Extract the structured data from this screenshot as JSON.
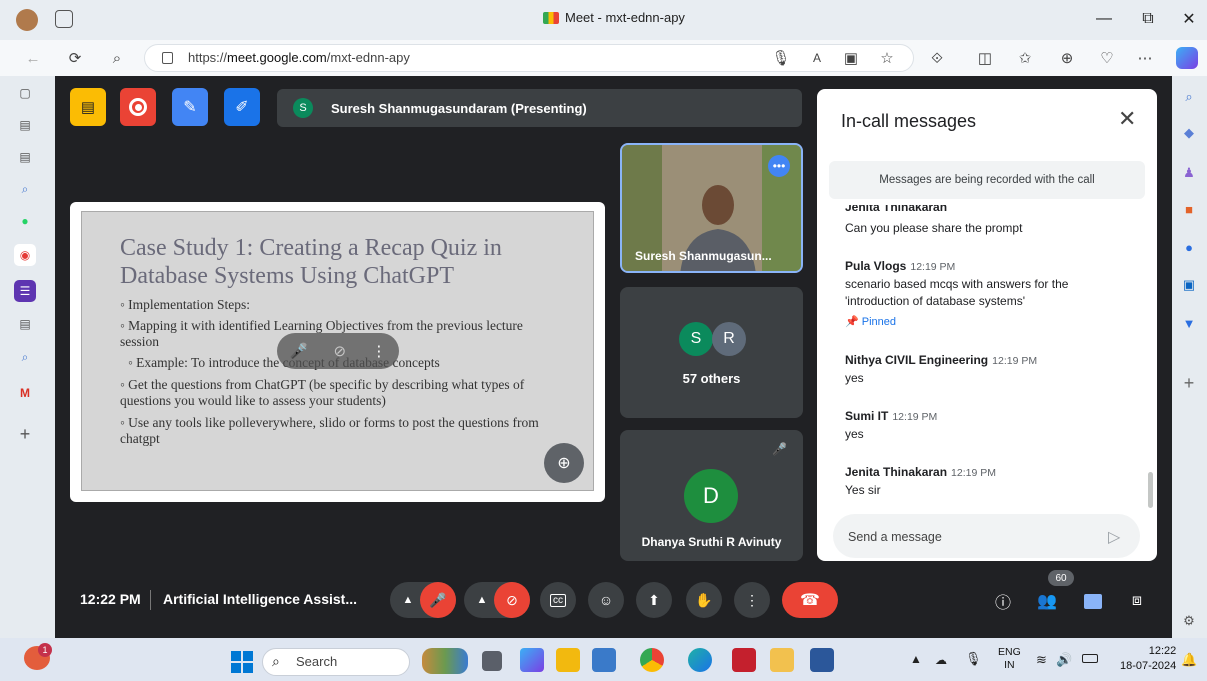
{
  "browser": {
    "tab_title": "Meet - mxt-ednn-apy",
    "url_prefix": "https://",
    "url_host": "meet.google.com",
    "url_path": "/mxt-ednn-apy"
  },
  "meet": {
    "presenting_initial": "S",
    "presenting_label": "Suresh Shanmugasundaram (Presenting)",
    "slide": {
      "title": "Case Study 1: Creating a Recap Quiz in Database Systems Using ChatGPT",
      "bullets": [
        "◦ Implementation Steps:",
        "◦ Mapping it with identified Learning Objectives from the previous lecture session",
        "◦ Example: To introduce the concept of database concepts",
        "◦ Get the questions from ChatGPT (be specific by describing what types of questions you would like to assess your students)",
        "◦ Use any tools like polleverywhere, slido or forms to post the questions from chatgpt"
      ]
    },
    "tiles": {
      "presenter_name": "Suresh Shanmugasun...",
      "group_initials": [
        "S",
        "R"
      ],
      "group_label": "57 others",
      "participant_initial": "D",
      "participant_name": "Dhanya Sruthi R Avinuty"
    },
    "bottom_bar": {
      "time": "12:22 PM",
      "meeting_name": "Artificial Intelligence Assist...",
      "people_count": "60"
    }
  },
  "chat": {
    "title": "In-call messages",
    "recording_notice": "Messages are being recorded with the call",
    "clipped_sender": "Jenita Thinakaran",
    "messages": [
      {
        "text": "Can you please share the prompt"
      },
      {
        "sender": "Pula Vlogs",
        "time": "12:19 PM",
        "text": "scenario based mcqs with answers for the 'introduction of database systems'",
        "pinned": "Pinned"
      },
      {
        "sender": "Nithya CIVIL Engineering",
        "time": "12:19 PM",
        "text": "yes"
      },
      {
        "sender": "Sumi IT",
        "time": "12:19 PM",
        "text": "yes"
      },
      {
        "sender": "Jenita Thinakaran",
        "time": "12:19 PM",
        "text": "Yes sir"
      }
    ],
    "input_placeholder": "Send a message"
  },
  "taskbar": {
    "search_placeholder": "Search",
    "notification_count": "1",
    "lang_line1": "ENG",
    "lang_line2": "IN",
    "clock_time": "12:22",
    "clock_date": "18-07-2024"
  },
  "colors": {
    "meet_bg": "#202124",
    "accent_blue": "#1a73e8",
    "end_call_red": "#ea4335",
    "presenter_green": "#0b8a5c"
  }
}
